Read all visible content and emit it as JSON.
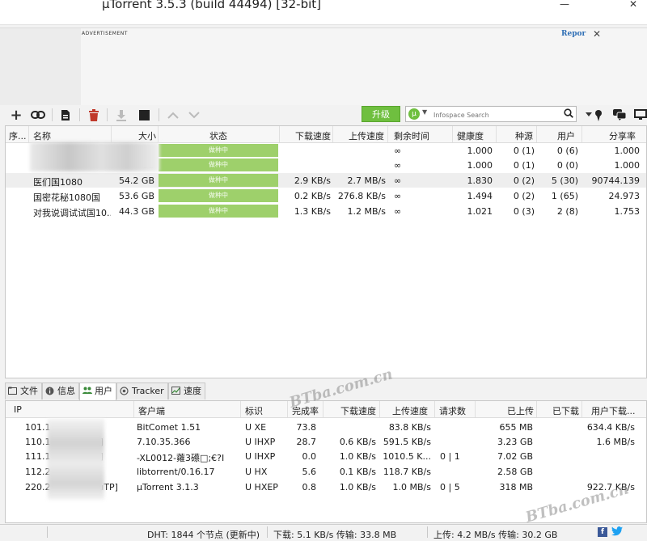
{
  "window": {
    "title": "µTorrent 3.5.3  (build 44494) [32-bit]",
    "minimize": "—",
    "close": "✕"
  },
  "ad": {
    "label": "ADVERTISEMENT",
    "report": "Repor",
    "close": "✕"
  },
  "toolbar": {
    "upgrade_label": "升级",
    "search_placeholder": "Infospace Search",
    "icons": [
      "add-torrent",
      "add-url",
      "create-torrent",
      "remove",
      "download",
      "stop",
      "up",
      "down",
      "remote",
      "chat",
      "monitor"
    ]
  },
  "torrent_list": {
    "columns": [
      "序...",
      "名称",
      "大小",
      "状态",
      "下载速度",
      "上传速度",
      "剩余时间",
      "健康度",
      "种源",
      "用户",
      "分享率"
    ],
    "rows": [
      {
        "name": "",
        "size": "",
        "status": "做种中",
        "down": "",
        "up": "",
        "eta": "∞",
        "health": "1.000",
        "seeds": "0 (1)",
        "peers": "0 (6)",
        "ratio": "1.000"
      },
      {
        "name": "",
        "size": "GB",
        "status": "做种中",
        "down": "",
        "up": "",
        "eta": "∞",
        "health": "1.000",
        "seeds": "0 (1)",
        "peers": "0 (0)",
        "ratio": "1.000"
      },
      {
        "name": "医们国1080",
        "size": "54.2 GB",
        "status": "做种中",
        "down": "2.9 KB/s",
        "up": "2.7 MB/s",
        "eta": "∞",
        "health": "1.830",
        "seeds": "0 (2)",
        "peers": "5 (30)",
        "ratio": "90744.139"
      },
      {
        "name": "国密花秘1080国",
        "size": "53.6 GB",
        "status": "做种中",
        "down": "0.2 KB/s",
        "up": "276.8 KB/s",
        "eta": "∞",
        "health": "1.494",
        "seeds": "0 (2)",
        "peers": "1 (65)",
        "ratio": "24.973"
      },
      {
        "name": "对我说调试试国10...",
        "size": "44.3 GB",
        "status": "做种中",
        "down": "1.3 KB/s",
        "up": "1.2 MB/s",
        "eta": "∞",
        "health": "1.021",
        "seeds": "0 (3)",
        "peers": "2 (8)",
        "ratio": "1.753"
      }
    ]
  },
  "tabs": [
    {
      "label": "文件",
      "icon": "file-icon"
    },
    {
      "label": "信息",
      "icon": "info-icon"
    },
    {
      "label": "用户",
      "icon": "peers-icon"
    },
    {
      "label": "Tracker",
      "icon": "tracker-icon"
    },
    {
      "label": "速度",
      "icon": "speed-icon"
    }
  ],
  "peers": {
    "columns": [
      "IP",
      "客户端",
      "标识",
      "完成率",
      "下载速度",
      "上传速度",
      "请求数",
      "已上传",
      "已下载",
      "用户下载..."
    ],
    "rows": [
      {
        "ip": "101.1",
        "client": "BitComet 1.51",
        "flags": "U XE",
        "pct": "73.8",
        "down": "",
        "up": "83.8 KB/s",
        "req": "",
        "uploaded": "655 MB",
        "downloaded": "",
        "peer_dl": "634.4 KB/s"
      },
      {
        "ip": "110.1",
        "ip_suffix": "P]",
        "client": "7.10.35.366",
        "flags": "U IHXP",
        "pct": "28.7",
        "down": "0.6 KB/s",
        "up": "591.5 KB/s",
        "req": "",
        "uploaded": "3.23 GB",
        "downloaded": "",
        "peer_dl": "1.6 MB/s"
      },
      {
        "ip": "111.1",
        "ip_suffix": "P]",
        "client": "-XL0012-蕹3礤□;€?I",
        "flags": "U IHXP",
        "pct": "0.0",
        "down": "1.0 KB/s",
        "up": "1010.5 K...",
        "req": "0 | 1",
        "uploaded": "7.02 GB",
        "downloaded": "",
        "peer_dl": ""
      },
      {
        "ip": "112.2",
        "client": "libtorrent/0.16.17",
        "flags": "U HX",
        "pct": "5.6",
        "down": "0.1 KB/s",
        "up": "118.7 KB/s",
        "req": "",
        "uploaded": "2.58 GB",
        "downloaded": "",
        "peer_dl": ""
      },
      {
        "ip": "220.2",
        "ip_suffix": "[uTP]",
        "client": "µTorrent 3.1.3",
        "flags": "U HXEP",
        "pct": "0.8",
        "down": "1.0 KB/s",
        "up": "1.0 MB/s",
        "req": "0 | 5",
        "uploaded": "318 MB",
        "downloaded": "",
        "peer_dl": "922.7 KB/s"
      }
    ]
  },
  "statusbar": {
    "dht": "DHT: 1844 个节点  (更新中)",
    "download": "下载: 5.1 KB/s 传输: 33.8 MB",
    "upload": "上传: 4.2 MB/s 传输: 30.2 GB",
    "facebook": "f",
    "twitter": "🐦"
  },
  "watermark": "BTba.com.cn"
}
